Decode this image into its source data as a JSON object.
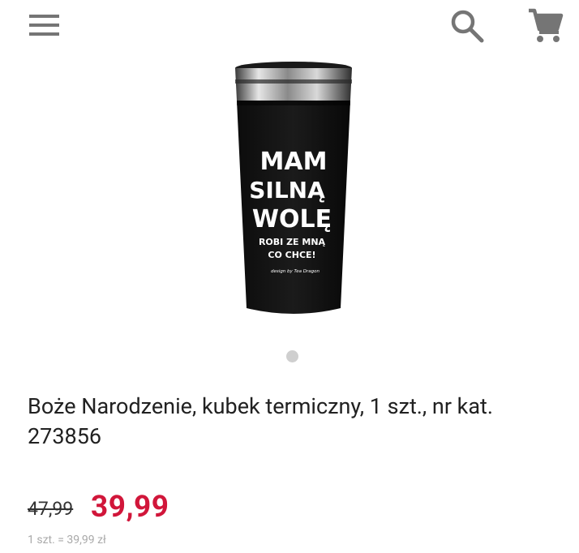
{
  "header": {
    "menu_icon": "hamburger-menu-icon",
    "search_icon": "search-icon",
    "cart_icon": "shopping-cart-icon",
    "icon_color": "#757575"
  },
  "product": {
    "image": {
      "mug_text_line1": "MAM",
      "mug_text_line2": "SILNĄ",
      "mug_text_line3": "WOLĘ",
      "mug_text_line4": "ROBI ZE MNĄ",
      "mug_text_line5": "CO CHCE!",
      "mug_signature": "design by Tea Dragon"
    },
    "carousel_dots": 1,
    "title": "Boże Narodzenie,  kubek termiczny, 1 szt., nr kat. 273856",
    "old_price": "47,99",
    "price": "39,99",
    "unit_price": "1 szt. = 39,99 zł",
    "price_color": "#d1163a"
  }
}
